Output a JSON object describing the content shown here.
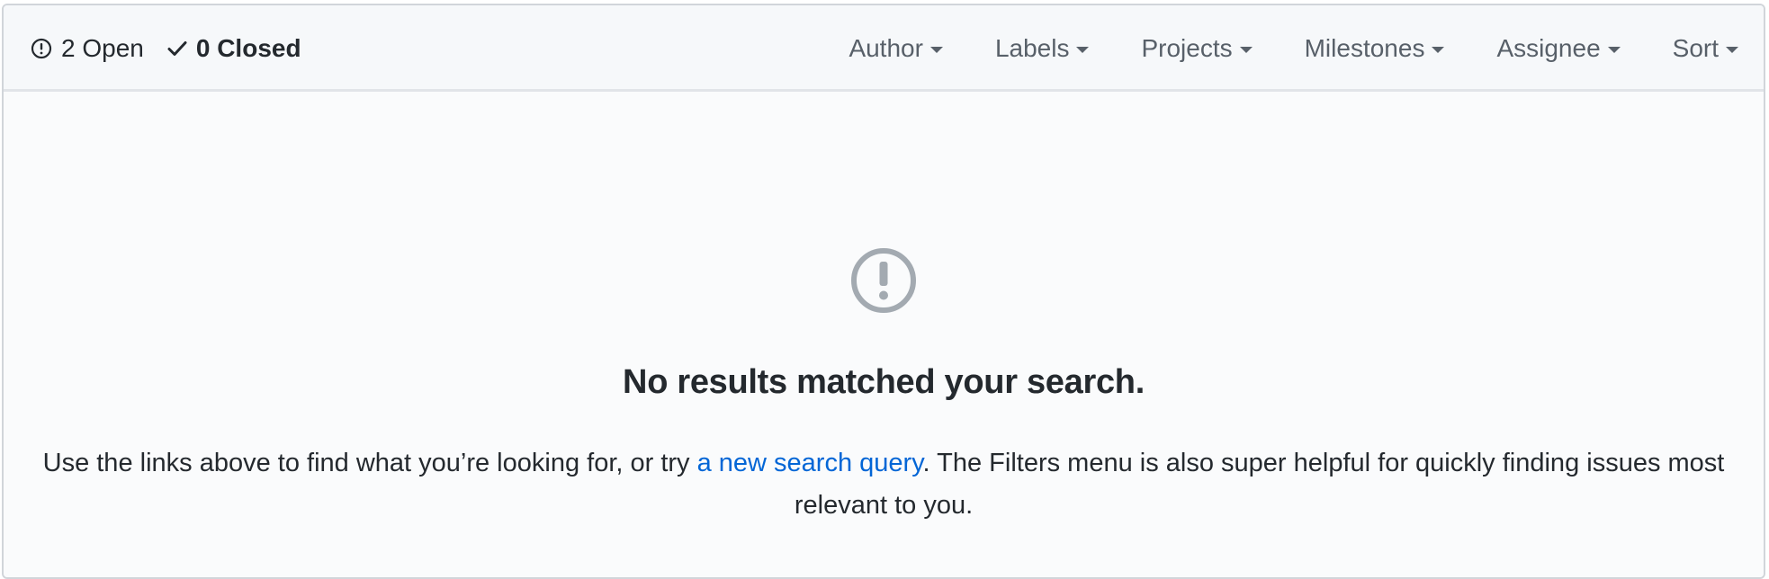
{
  "header": {
    "open_count": "2 Open",
    "closed_count": "0 Closed",
    "filters": [
      {
        "label": "Author",
        "icon": "caret-down-icon"
      },
      {
        "label": "Labels",
        "icon": "caret-down-icon"
      },
      {
        "label": "Projects",
        "icon": "caret-down-icon"
      },
      {
        "label": "Milestones",
        "icon": "caret-down-icon"
      },
      {
        "label": "Assignee",
        "icon": "caret-down-icon"
      },
      {
        "label": "Sort",
        "icon": "caret-down-icon"
      }
    ]
  },
  "blankslate": {
    "icon": "issue-opened-icon",
    "title": "No results matched your search.",
    "text_before": "Use the links above to find what you’re looking for, or try ",
    "link_text": "a new search query",
    "text_after": ". The Filters menu is also super helpful for quickly finding issues most relevant to you."
  },
  "colors": {
    "link": "#0366d6",
    "text": "#24292e",
    "muted": "#586069",
    "icon_gray": "#a3aab1",
    "header_bg": "#f6f8fa",
    "body_bg": "#fafbfc"
  }
}
